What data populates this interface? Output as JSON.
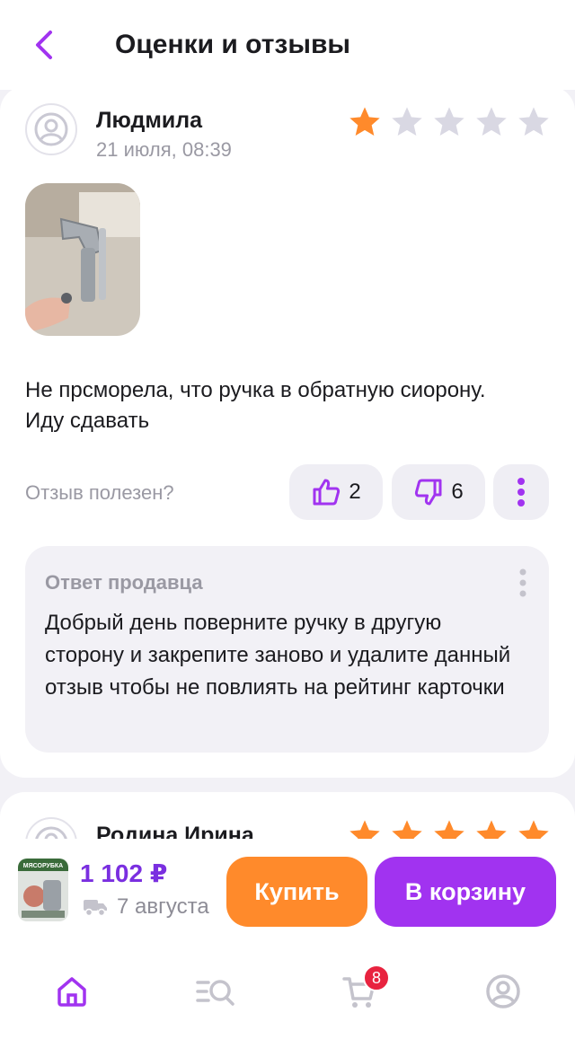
{
  "header": {
    "title": "Оценки и отзывы"
  },
  "review": {
    "author": "Людмила",
    "date": "21 июля, 08:39",
    "rating": 1,
    "rating_max": 5,
    "text": "Не прсморела, что ручка в обратную сиорону. Иду сдавать",
    "helpful_label": "Отзыв полезен?",
    "likes": "2",
    "dislikes": "6",
    "seller_reply_title": "Ответ продавца",
    "seller_reply_text": "Добрый день поверните ручку в другую сторону и закрепите заново  и удалите данный отзыв чтобы не повлиять на рейтинг карточки"
  },
  "next_review": {
    "author": "Родина Ирина",
    "rating": 5,
    "rating_max": 5
  },
  "buybar": {
    "price": "1 102 ₽",
    "delivery_date": "7 августа",
    "buy_label": "Купить",
    "cart_label": "В корзину",
    "thumb_caption": "МЯСОРУБКА"
  },
  "tabbar": {
    "cart_badge": "8",
    "icons": [
      "home-icon",
      "catalog-search-icon",
      "cart-icon",
      "profile-icon"
    ]
  },
  "colors": {
    "accent": "#a133f0",
    "orange": "#ff8a2b",
    "star_filled": "#ff8a2b",
    "star_empty": "#d9d8e3",
    "badge": "#e8233f"
  }
}
